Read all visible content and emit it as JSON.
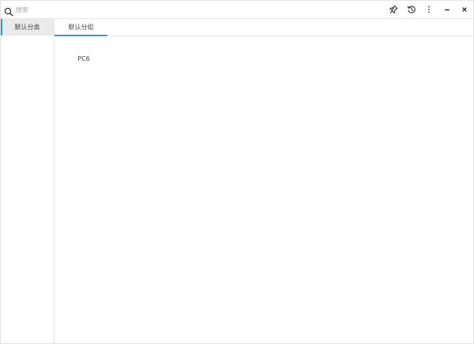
{
  "search": {
    "placeholder": "搜索",
    "value": ""
  },
  "toolbar": {
    "icons": [
      "pin-icon",
      "history-icon",
      "more-vertical-icon",
      "minimize-icon",
      "close-icon"
    ]
  },
  "sidebar": {
    "items": [
      {
        "label": "默认分类",
        "active": true
      }
    ]
  },
  "tabs": [
    {
      "label": "默认分组",
      "active": true
    }
  ],
  "content": {
    "items": [
      {
        "label": "PC6"
      }
    ]
  },
  "colors": {
    "accent": "#2b9bd8",
    "sidebar_active_bg": "#eaeaea",
    "border": "#e6e6e6",
    "text": "#444444"
  }
}
